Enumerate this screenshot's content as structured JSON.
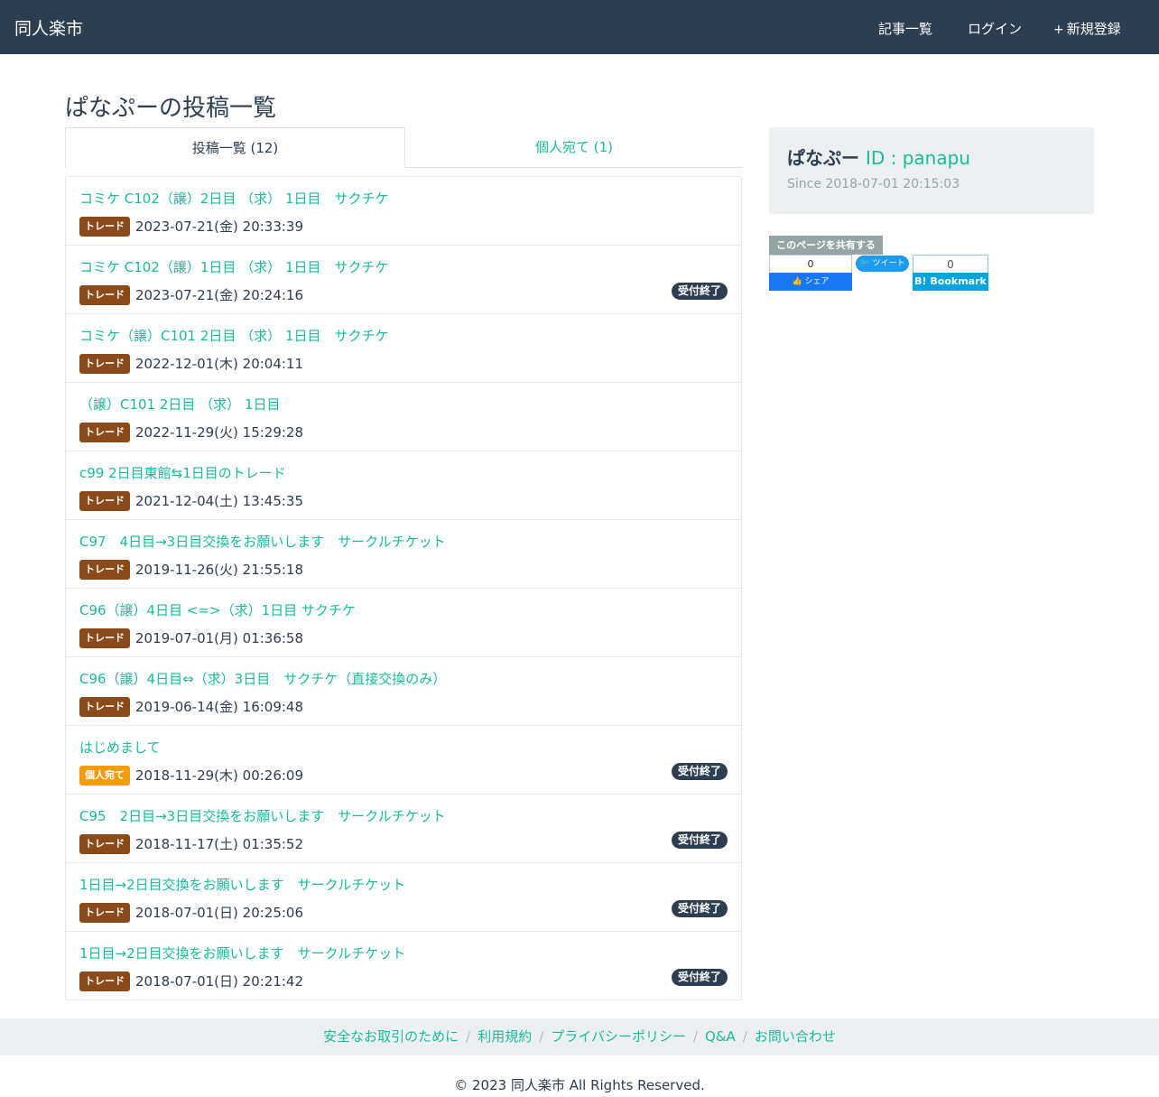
{
  "nav": {
    "brand": "同人楽市",
    "items": [
      {
        "icon": "",
        "label": "記事一覧"
      },
      {
        "icon": "",
        "label": "ログイン"
      },
      {
        "icon": "+",
        "label": "新規登録"
      }
    ]
  },
  "page_title": "ぱなぷーの投稿一覧",
  "tabs": [
    {
      "label": "投稿一覧 (12)",
      "active": true
    },
    {
      "label": "個人宛て (1)",
      "active": false
    }
  ],
  "posts": [
    {
      "title": "コミケ C102（譲）2日目 （求） 1日目　サクチケ",
      "category": "トレード",
      "date": "2023-07-21(金) 20:33:39",
      "status": ""
    },
    {
      "title": "コミケ C102（譲）1日目 （求） 1日目　サクチケ",
      "category": "トレード",
      "date": "2023-07-21(金) 20:24:16",
      "status": "受付終了"
    },
    {
      "title": "コミケ（譲）C101 2日目 （求） 1日目　サクチケ",
      "category": "トレード",
      "date": "2022-12-01(木) 20:04:11",
      "status": ""
    },
    {
      "title": "（譲）C101 2日目 （求） 1日目",
      "category": "トレード",
      "date": "2022-11-29(火) 15:29:28",
      "status": ""
    },
    {
      "title": "c99 2日目東館⇆1日目のトレード",
      "category": "トレード",
      "date": "2021-12-04(土) 13:45:35",
      "status": ""
    },
    {
      "title": "C97　4日目→3日目交換をお願いします　サークルチケット",
      "category": "トレード",
      "date": "2019-11-26(火) 21:55:18",
      "status": ""
    },
    {
      "title": "C96（譲）4日目 <=>（求）1日目 サクチケ",
      "category": "トレード",
      "date": "2019-07-01(月) 01:36:58",
      "status": ""
    },
    {
      "title": "C96（譲）4日目⇔（求）3日目　サクチケ（直接交換のみ）",
      "category": "トレード",
      "date": "2019-06-14(金) 16:09:48",
      "status": ""
    },
    {
      "title": "はじめまして",
      "category": "個人宛て",
      "date": "2018-11-29(木) 00:26:09",
      "status": "受付終了"
    },
    {
      "title": "C95　2日目→3日目交換をお願いします　サークルチケット",
      "category": "トレード",
      "date": "2018-11-17(土) 01:35:52",
      "status": "受付終了"
    },
    {
      "title": "1日目→2日目交換をお願いします　サークルチケット",
      "category": "トレード",
      "date": "2018-07-01(日) 20:25:06",
      "status": "受付終了"
    },
    {
      "title": "1日目→2日目交換をお願いします　サークルチケット",
      "category": "トレード",
      "date": "2018-07-01(日) 20:21:42",
      "status": "受付終了"
    }
  ],
  "profile": {
    "icon": "",
    "name": "ぱなぷー",
    "id_label": "ID : panapu",
    "since": "Since 2018-07-01 20:15:03"
  },
  "share": {
    "label": "このページを共有する",
    "facebook_count": "0",
    "facebook_label": "シェア",
    "twitter_label": "ツイート",
    "hatena_count": "0",
    "hatena_label": "B! Bookmark"
  },
  "footer": {
    "links": [
      "安全なお取引のために",
      "利用規約",
      "プライバシーポリシー",
      "Q&A",
      "お問い合わせ"
    ],
    "copyright": "© 2023 同人楽市 All Rights Reserved."
  },
  "colors": {
    "navbar": "#2c3e50",
    "link": "#18bc9c",
    "trade_badge": "#8b4a1c",
    "personal_badge": "#f39c12",
    "closed_badge": "#2c3e50"
  }
}
